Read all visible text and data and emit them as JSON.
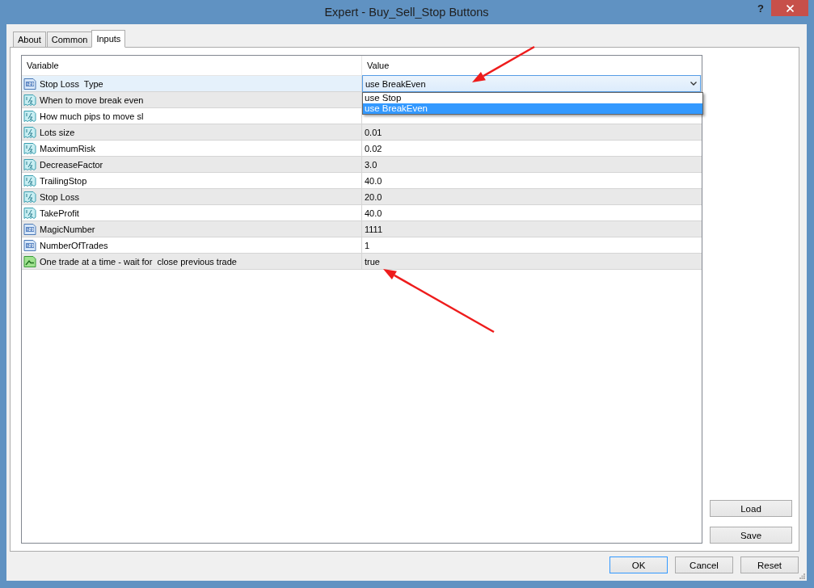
{
  "window": {
    "title": "Expert - Buy_Sell_Stop Buttons",
    "help_label": "?"
  },
  "tabs": [
    {
      "label": "About",
      "selected": false
    },
    {
      "label": "Common",
      "selected": false
    },
    {
      "label": "Inputs",
      "selected": true
    }
  ],
  "table": {
    "columns": [
      "Variable",
      "Value"
    ],
    "rows": [
      {
        "kind": "int",
        "name": "Stop Loss  Type",
        "selected": true,
        "dropdown": {
          "value": "use BreakEven",
          "open": true,
          "options": [
            {
              "label": "use Stop",
              "selected": false
            },
            {
              "label": "use BreakEven",
              "selected": true
            }
          ]
        }
      },
      {
        "kind": "double",
        "name": "When to move break even",
        "selected": false
      },
      {
        "kind": "double",
        "name": "How much pips to move sl",
        "selected": false
      },
      {
        "kind": "double",
        "name": "Lots size",
        "value": "0.01",
        "selected": false
      },
      {
        "kind": "double",
        "name": "MaximumRisk",
        "value": "0.02",
        "selected": false
      },
      {
        "kind": "double",
        "name": "DecreaseFactor",
        "value": "3.0",
        "selected": false
      },
      {
        "kind": "double",
        "name": "TrailingStop",
        "value": "40.0",
        "selected": false
      },
      {
        "kind": "double",
        "name": "Stop Loss",
        "value": "20.0",
        "selected": false
      },
      {
        "kind": "double",
        "name": "TakeProfit",
        "value": "40.0",
        "selected": false
      },
      {
        "kind": "int",
        "name": "MagicNumber",
        "value": "1111",
        "selected": false
      },
      {
        "kind": "int",
        "name": "NumberOfTrades",
        "value": "1",
        "selected": false
      },
      {
        "kind": "bool",
        "name": "One trade at a time - wait for  close previous trade",
        "value": "true",
        "selected": false
      }
    ]
  },
  "side_buttons": [
    "Load",
    "Save"
  ],
  "buttons": [
    {
      "label": "OK",
      "default": true
    },
    {
      "label": "Cancel",
      "default": false
    },
    {
      "label": "Reset",
      "default": false
    }
  ]
}
